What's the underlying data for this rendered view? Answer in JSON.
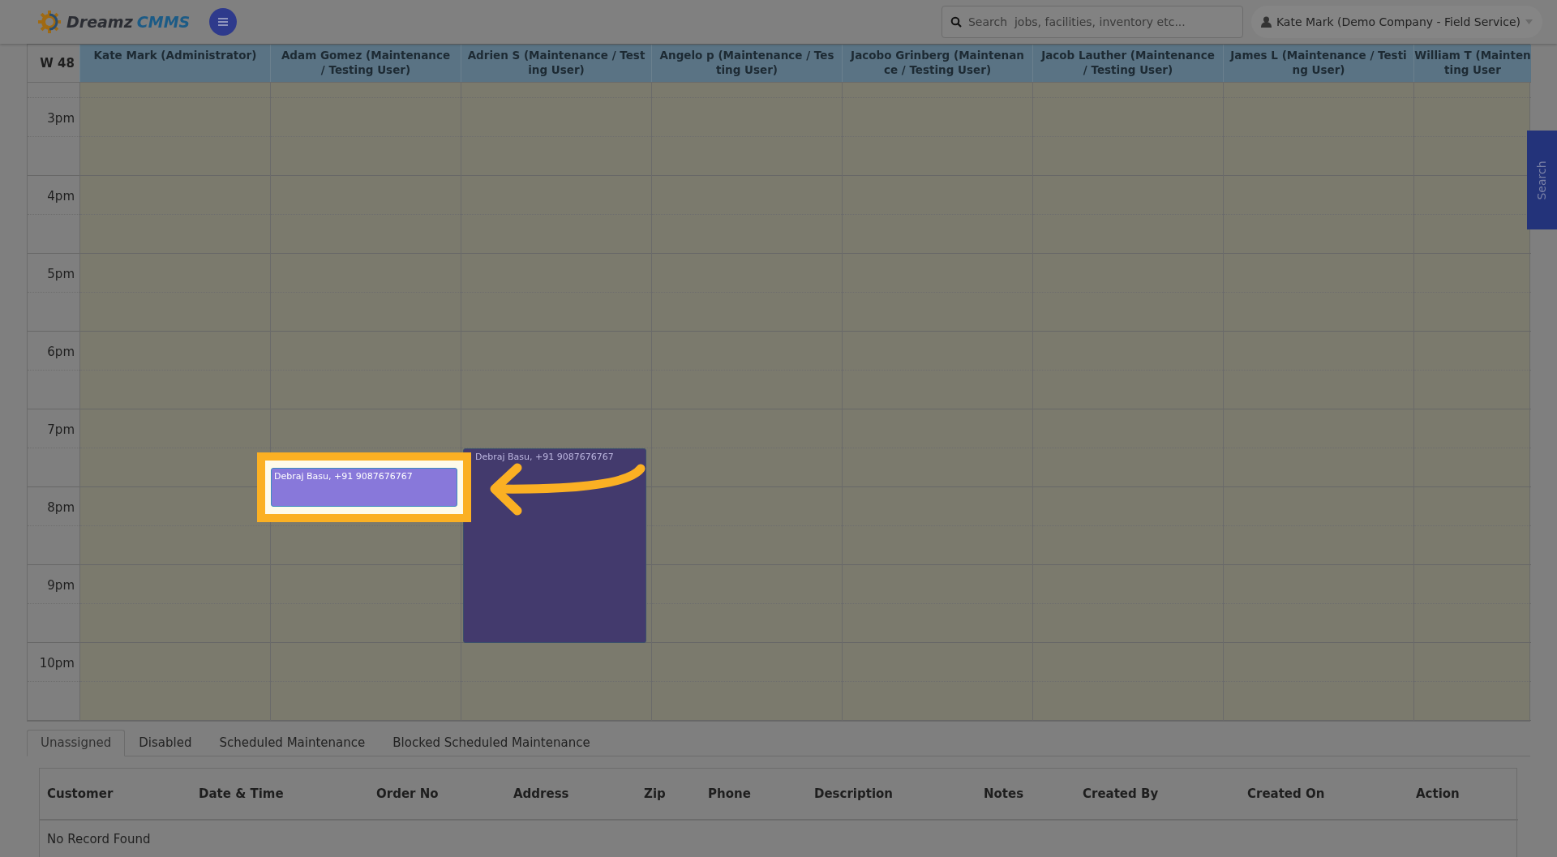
{
  "brand": {
    "word": "Dreamz",
    "accent": "CMMS"
  },
  "search": {
    "placeholder": "Search  jobs, facilities, inventory etc..."
  },
  "user": {
    "label": "Kate Mark (Demo Company - Field Service)"
  },
  "side_tab": {
    "label": "Search"
  },
  "calendar": {
    "week": "W 48",
    "columns": [
      {
        "lines": [
          "Kate Mark (Administrator)"
        ]
      },
      {
        "lines": [
          "Adam Gomez (Maintenance",
          "/ Testing User)"
        ]
      },
      {
        "lines": [
          "Adrien S (Maintenance / Test",
          "ing User)"
        ]
      },
      {
        "lines": [
          "Angelo p (Maintenance / Tes",
          "ting User)"
        ]
      },
      {
        "lines": [
          "Jacobo Grinberg (Maintenan",
          "ce / Testing User)"
        ]
      },
      {
        "lines": [
          "Jacob Lauther (Maintenance",
          "/ Testing User)"
        ]
      },
      {
        "lines": [
          "James L (Maintenance / Testi",
          "ng User)"
        ]
      },
      {
        "lines": [
          "William T (Mainten",
          "ting User"
        ]
      }
    ],
    "hours": [
      "3pm",
      "4pm",
      "5pm",
      "6pm",
      "7pm",
      "8pm",
      "9pm",
      "10pm"
    ],
    "events": [
      {
        "title": "Debraj Basu, +91 9087676767",
        "highlighted": true
      },
      {
        "title": "Debraj Basu, +91 9087676767",
        "highlighted": false
      }
    ]
  },
  "tabs": [
    {
      "label": "Unassigned",
      "selected": true
    },
    {
      "label": "Disabled",
      "selected": false
    },
    {
      "label": "Scheduled Maintenance",
      "selected": false
    },
    {
      "label": "Blocked Scheduled Maintenance",
      "selected": false
    }
  ],
  "table": {
    "columns": [
      "Customer",
      "Date & Time",
      "Order No",
      "Address",
      "Zip",
      "Phone",
      "Description",
      "Notes",
      "Created By",
      "Created On",
      "Action"
    ],
    "empty": "No Record Found"
  }
}
